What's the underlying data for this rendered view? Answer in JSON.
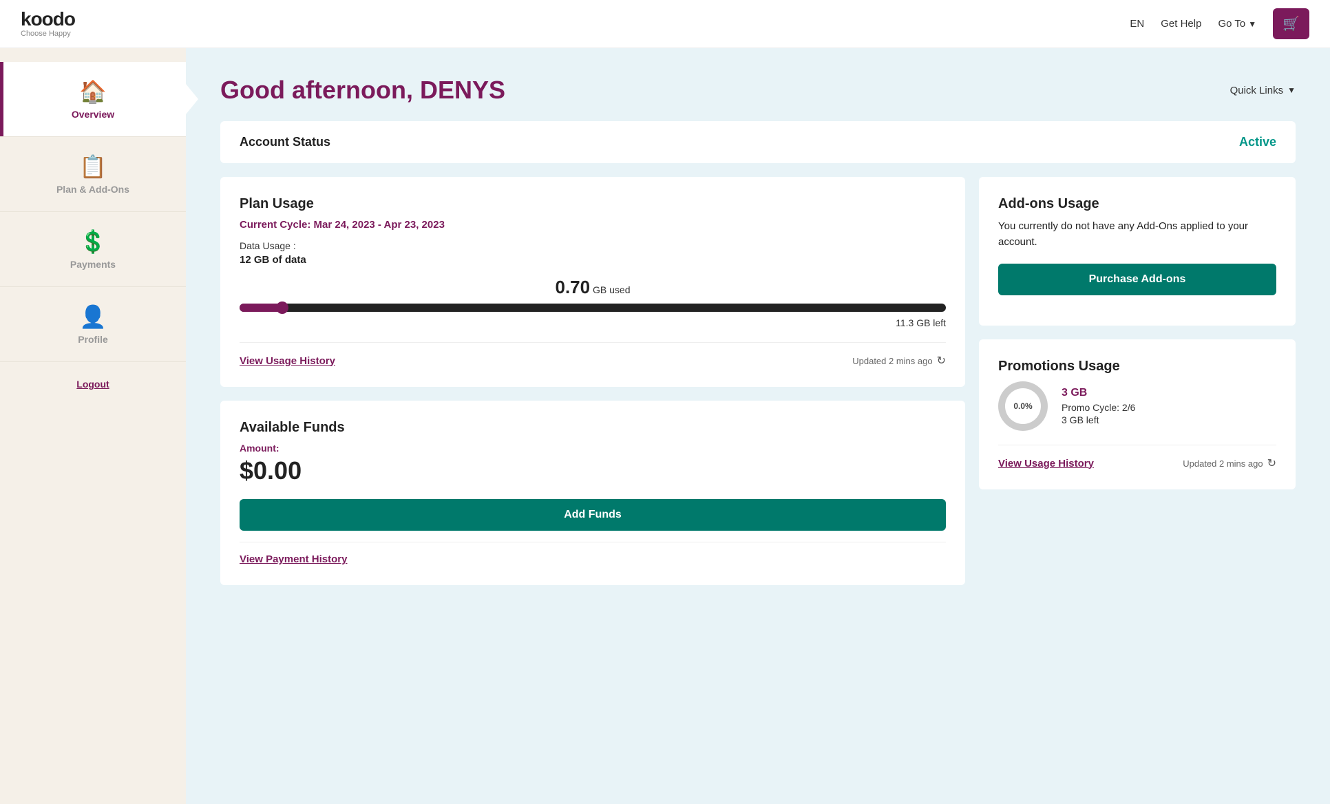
{
  "header": {
    "logo_main": "koodo",
    "logo_sub": "Choose Happy",
    "nav_en": "EN",
    "nav_help": "Get Help",
    "nav_goto": "Go To",
    "cart_icon": "🛒"
  },
  "sidebar": {
    "items": [
      {
        "id": "overview",
        "label": "Overview",
        "icon": "🏠",
        "active": true
      },
      {
        "id": "plan-addons",
        "label": "Plan & Add-Ons",
        "icon": "📋",
        "active": false
      },
      {
        "id": "payments",
        "label": "Payments",
        "icon": "💲",
        "active": false
      },
      {
        "id": "profile",
        "label": "Profile",
        "icon": "👤",
        "active": false
      }
    ],
    "logout_label": "Logout"
  },
  "main": {
    "greeting": "Good afternoon, DENYS",
    "quick_links": "Quick Links",
    "account_status_label": "Account Status",
    "account_status_value": "Active",
    "plan_usage": {
      "title": "Plan Usage",
      "cycle": "Current Cycle: Mar 24, 2023 - Apr 23, 2023",
      "data_label": "Data Usage :",
      "data_amount": "12 GB of data",
      "gb_used": "0.70",
      "gb_used_unit": "GB used",
      "gb_left": "11.3 GB left",
      "bar_percent": 6,
      "view_history": "View Usage History",
      "updated": "Updated 2 mins ago"
    },
    "available_funds": {
      "title": "Available Funds",
      "amount_label": "Amount:",
      "amount": "$0.00",
      "add_funds_btn": "Add Funds",
      "view_payment_history": "View Payment History"
    },
    "addons_usage": {
      "title": "Add-ons Usage",
      "desc": "You currently do not have any Add-Ons applied to your account.",
      "purchase_btn": "Purchase Add-ons"
    },
    "promotions_usage": {
      "title": "Promotions Usage",
      "promo_title": "3 GB",
      "promo_cycle": "Promo Cycle: 2/6",
      "promo_left": "3 GB left",
      "promo_percent": "0.0%",
      "view_history": "View Usage History",
      "updated": "Updated 2 mins ago"
    }
  }
}
